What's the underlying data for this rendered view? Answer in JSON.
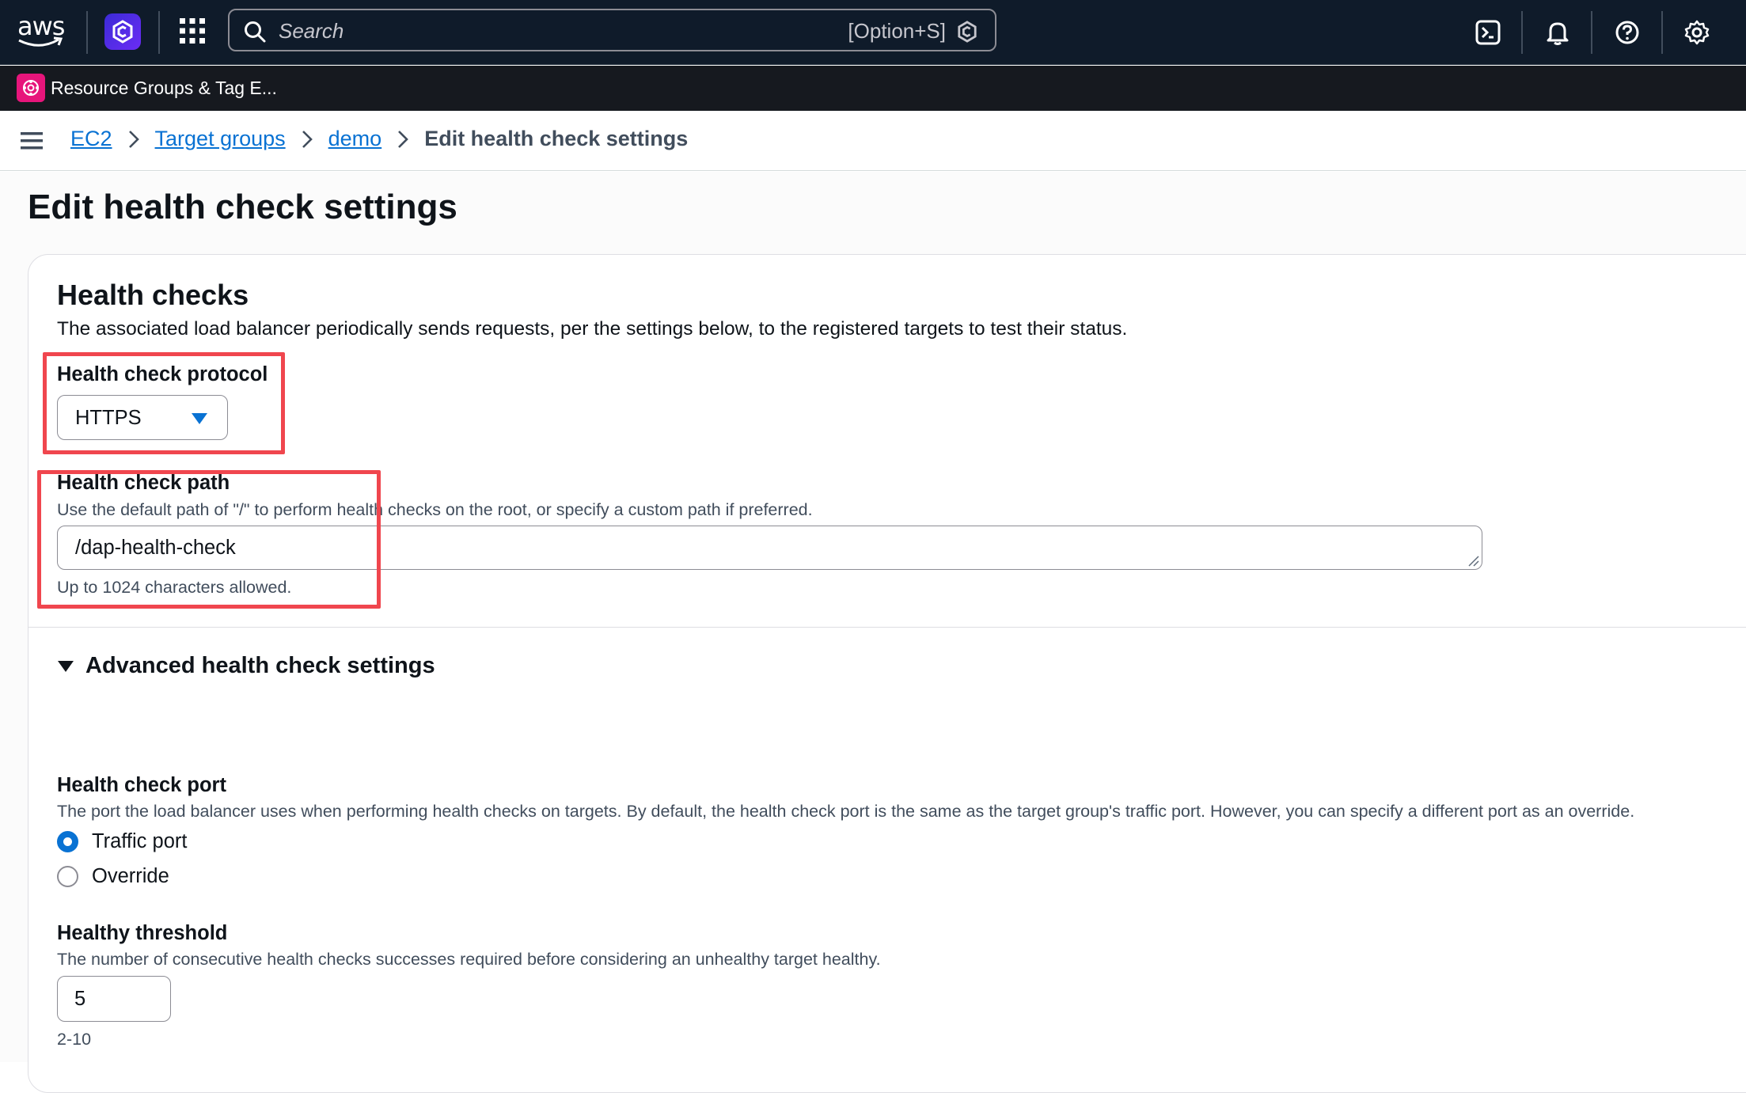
{
  "topnav": {
    "logo_text": "aws",
    "search_placeholder": "Search",
    "search_shortcut": "[Option+S]",
    "icons": [
      "cloudshell-icon",
      "notifications-icon",
      "help-icon",
      "settings-icon"
    ]
  },
  "service_bar": {
    "service_label": "Resource Groups & Tag E..."
  },
  "breadcrumb": {
    "items": [
      "EC2",
      "Target groups",
      "demo"
    ],
    "current": "Edit health check settings"
  },
  "page": {
    "title": "Edit health check settings"
  },
  "health_checks": {
    "title": "Health checks",
    "description": "The associated load balancer periodically sends requests, per the settings below, to the registered targets to test their status.",
    "protocol": {
      "label": "Health check protocol",
      "value": "HTTPS"
    },
    "path": {
      "label": "Health check path",
      "description": "Use the default path of \"/\" to perform health checks on the root, or specify a custom path if preferred.",
      "value": "/dap-health-check",
      "constraint": "Up to 1024 characters allowed."
    }
  },
  "advanced": {
    "title": "Advanced health check settings",
    "port": {
      "label": "Health check port",
      "description": "The port the load balancer uses when performing health checks on targets. By default, the health check port is the same as the target group's traffic port. However, you can specify a different port as an override.",
      "options": [
        "Traffic port",
        "Override"
      ],
      "selected": "Traffic port"
    },
    "healthy_threshold": {
      "label": "Healthy threshold",
      "description": "The number of consecutive health checks successes required before considering an unhealthy target healthy.",
      "value": "5",
      "constraint": "2-10"
    }
  },
  "colors": {
    "nav_bg": "#0f1b2a",
    "link": "#0972d3",
    "annotation_box": "#f0464e",
    "service_badge": "#e7157b"
  }
}
